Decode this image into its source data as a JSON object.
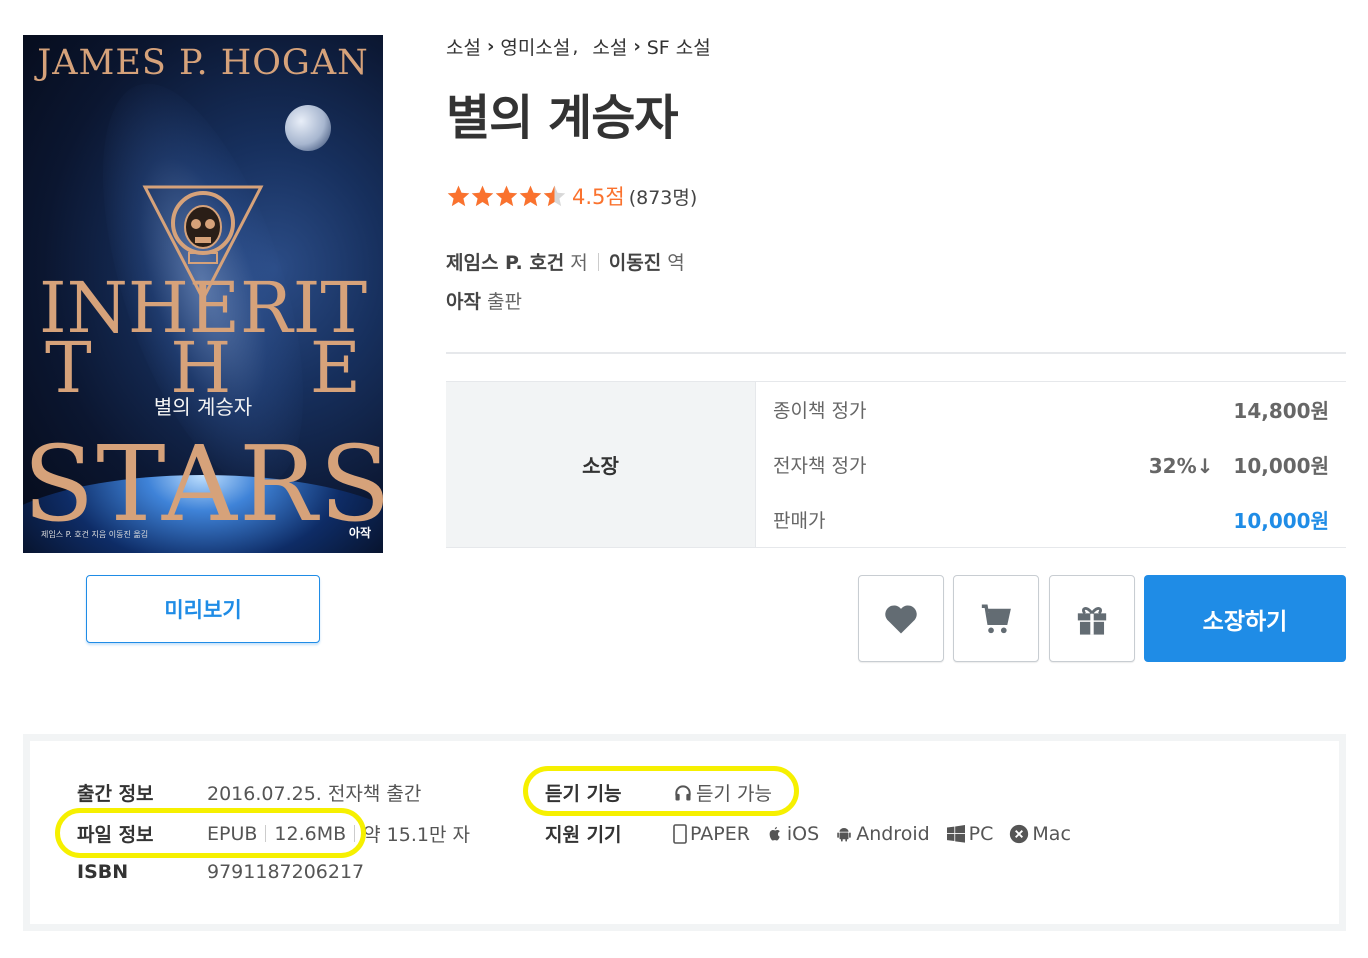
{
  "cover": {
    "author": "JAMES P. HOGAN",
    "title_line1": "INHERIT",
    "title_line2": [
      "T",
      "H",
      "E"
    ],
    "title_line3": "STARS",
    "korean_title": "별의 계승자",
    "credit": "제임스 P. 호건 지음 이동진 옮김",
    "publisher": "아작"
  },
  "preview_label": "미리보기",
  "breadcrumb": [
    {
      "label": "소설"
    },
    {
      "label": "영미소설"
    },
    {
      "label": "소설"
    },
    {
      "label": "SF 소설"
    }
  ],
  "breadcrumb_separator": ",",
  "title": "별의 계승자",
  "rating": {
    "score": "4.5점",
    "count": "(873명)",
    "stars": 4.5,
    "star_color": "#fa722e"
  },
  "authors": [
    {
      "name": "제임스 P. 호건",
      "role": "저"
    },
    {
      "name": "이동진",
      "role": "역"
    }
  ],
  "publisher": {
    "name": "아작",
    "role": "출판"
  },
  "price": {
    "label": "소장",
    "rows": [
      {
        "label": "종이책 정가",
        "value": "14,800원"
      },
      {
        "label": "전자책 정가",
        "discount": "32%↓",
        "value": "10,000원"
      },
      {
        "label": "판매가",
        "value": "10,000원"
      }
    ]
  },
  "actions": {
    "buy_label": "소장하기",
    "accent": "#1f8ce6"
  },
  "info": {
    "release_key": "출간 정보",
    "release_val": "2016.07.25. 전자책 출간",
    "file_key": "파일 정보",
    "file_format": "EPUB",
    "file_size": "12.6MB",
    "file_chars": "약 15.1만 자",
    "isbn_key": "ISBN",
    "isbn_val": "9791187206217",
    "listen_key": "듣기 기능",
    "listen_val": "듣기 가능",
    "devices_key": "지원 기기",
    "devices": [
      {
        "icon": "phone-icon",
        "label": "PAPER"
      },
      {
        "icon": "apple-icon",
        "label": "iOS"
      },
      {
        "icon": "android-icon",
        "label": "Android"
      },
      {
        "icon": "windows-icon",
        "label": "PC"
      },
      {
        "icon": "mac-x-icon",
        "label": "Mac"
      }
    ]
  },
  "highlight_color": "#f6f000"
}
